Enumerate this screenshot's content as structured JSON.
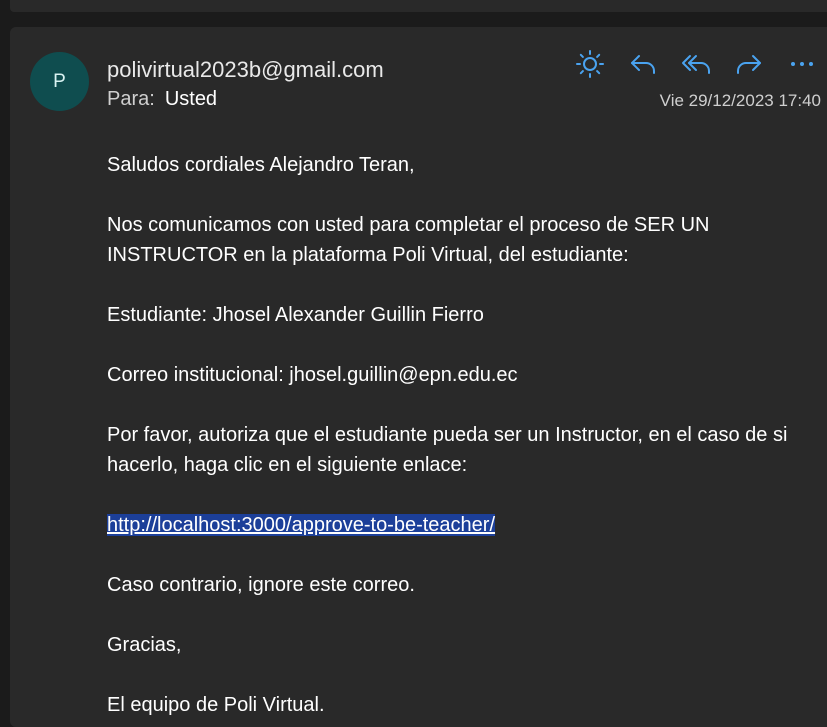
{
  "email": {
    "avatar_initial": "P",
    "sender": "polivirtual2023b@gmail.com",
    "to_label": "Para:",
    "to_value": "Usted",
    "date": "Vie 29/12/2023 17:40"
  },
  "actions": {
    "icons": [
      "sun-icon",
      "reply-icon",
      "reply-all-icon",
      "forward-icon",
      "more-icon"
    ]
  },
  "body": {
    "greeting": "Saludos cordiales Alejandro Teran,",
    "intro": "Nos comunicamos con usted para completar el proceso de SER UN INSTRUCTOR en la plataforma Poli Virtual, del estudiante:",
    "student": "Estudiante: Jhosel Alexander Guillin Fierro",
    "email": "Correo institucional: jhosel.guillin@epn.edu.ec",
    "request": "Por favor, autoriza que el estudiante pueda ser un Instructor, en el caso de si hacerlo, haga clic en el siguiente enlace:",
    "link": "http://localhost:3000/approve-to-be-teacher/",
    "otherwise": "Caso contrario, ignore este correo.",
    "thanks": "Gracias,",
    "signature": "El equipo de Poli Virtual."
  },
  "colors": {
    "background": "#1b1b1b",
    "card": "#292929",
    "avatar": "#0f4d4f",
    "icon_accent": "#4aa3f0",
    "link_highlight": "#1c3f99"
  }
}
